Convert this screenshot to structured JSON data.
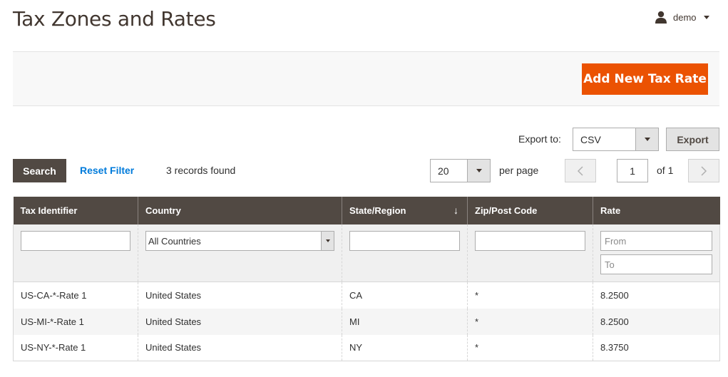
{
  "page": {
    "title": "Tax Zones and Rates"
  },
  "user": {
    "name": "demo",
    "icon": "user-icon"
  },
  "actions": {
    "add_label": "Add New Tax Rate",
    "add_color": "#eb5202"
  },
  "export": {
    "label": "Export to:",
    "format": "CSV",
    "button": "Export"
  },
  "toolbar": {
    "search_label": "Search",
    "reset_label": "Reset Filter",
    "records": "3 records found",
    "per_page_value": "20",
    "per_page_label": "per page",
    "page_value": "1",
    "of_label": "of 1"
  },
  "grid": {
    "columns": [
      "Tax Identifier",
      "Country",
      "State/Region",
      "Zip/Post Code",
      "Rate"
    ],
    "sort_indicator": "↓",
    "filters": {
      "country_value": "All Countries",
      "rate_from_placeholder": "From",
      "rate_to_placeholder": "To"
    },
    "rows": [
      [
        "US-CA-*-Rate 1",
        "United States",
        "CA",
        "*",
        "8.2500"
      ],
      [
        "US-MI-*-Rate 1",
        "United States",
        "MI",
        "*",
        "8.2500"
      ],
      [
        "US-NY-*-Rate 1",
        "United States",
        "NY",
        "*",
        "8.3750"
      ]
    ]
  },
  "colors": {
    "header_bg": "#514943",
    "link": "#007bdb",
    "accent": "#eb5202"
  }
}
